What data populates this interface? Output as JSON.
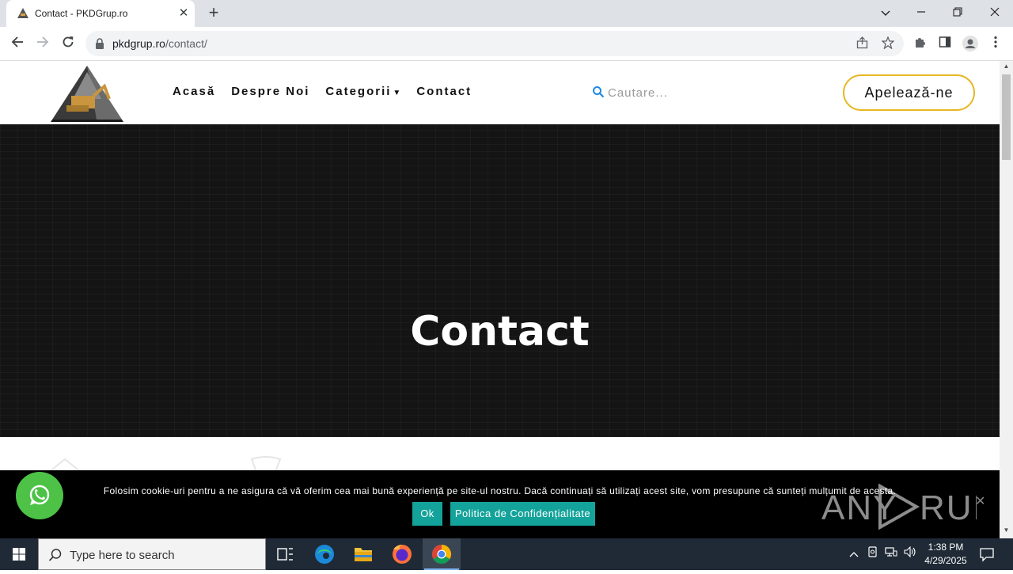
{
  "browser": {
    "tab_title": "Contact - PKDGrup.ro",
    "url_domain": "pkdgrup.ro",
    "url_path": "/contact/"
  },
  "site": {
    "nav": [
      "Acasă",
      "Despre Noi",
      "Categorii",
      "Contact"
    ],
    "search_placeholder": "Cautare...",
    "call_button": "Apelează-ne",
    "hero_title": "Contact",
    "accent_color": "#e7b824"
  },
  "cookie": {
    "text": "Folosim cookie-uri pentru a ne asigura că vă oferim cea mai bună experiență pe site-ul nostru. Dacă continuați să utilizați acest site, vom presupune că sunteți mulțumit de acesta.",
    "ok_label": "Ok",
    "policy_label": "Politica de Confidențialitate",
    "button_color": "#14a39a"
  },
  "watermark": "ANY RUN",
  "taskbar": {
    "search_placeholder": "Type here to search",
    "time": "1:38 PM",
    "date": "4/29/2025"
  }
}
